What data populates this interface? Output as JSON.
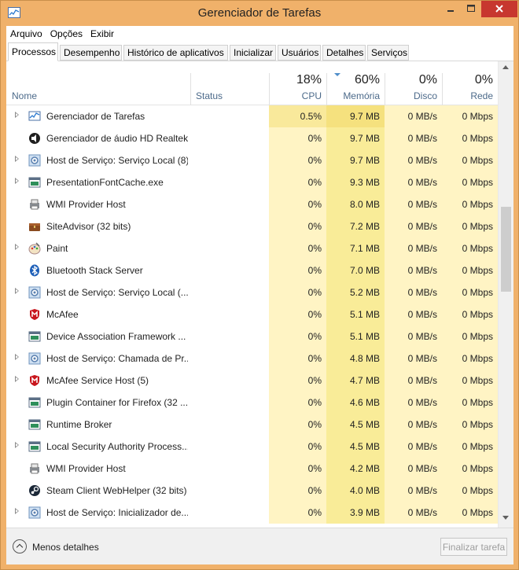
{
  "window": {
    "title": "Gerenciador de Tarefas",
    "controls": {
      "minimize": "–",
      "maximize": "□",
      "close": "✕"
    }
  },
  "menu": [
    "Arquivo",
    "Opções",
    "Exibir"
  ],
  "tabs": [
    "Processos",
    "Desempenho",
    "Histórico de aplicativos",
    "Inicializar",
    "Usuários",
    "Detalhes",
    "Serviços"
  ],
  "active_tab": "Processos",
  "columns": {
    "name": "Nome",
    "status": "Status",
    "cpu": {
      "percent": "18%",
      "label": "CPU"
    },
    "memory": {
      "percent": "60%",
      "label": "Memória"
    },
    "disk": {
      "percent": "0%",
      "label": "Disco"
    },
    "network": {
      "percent": "0%",
      "label": "Rede"
    }
  },
  "processes": [
    {
      "name": "Gerenciador de Tarefas",
      "cpu": "0.5%",
      "memory": "9.7 MB",
      "disk": "0 MB/s",
      "network": "0 Mbps",
      "icon": "task-manager-icon",
      "expandable": true
    },
    {
      "name": "Gerenciador de áudio HD Realtek",
      "cpu": "0%",
      "memory": "9.7 MB",
      "disk": "0 MB/s",
      "network": "0 Mbps",
      "icon": "speaker-icon",
      "expandable": false
    },
    {
      "name": "Host de Serviço: Serviço Local (8)",
      "cpu": "0%",
      "memory": "9.7 MB",
      "disk": "0 MB/s",
      "network": "0 Mbps",
      "icon": "gear-icon",
      "expandable": true
    },
    {
      "name": "PresentationFontCache.exe",
      "cpu": "0%",
      "memory": "9.3 MB",
      "disk": "0 MB/s",
      "network": "0 Mbps",
      "icon": "window-icon",
      "expandable": true
    },
    {
      "name": "WMI Provider Host",
      "cpu": "0%",
      "memory": "8.0 MB",
      "disk": "0 MB/s",
      "network": "0 Mbps",
      "icon": "printer-icon",
      "expandable": false
    },
    {
      "name": "SiteAdvisor (32 bits)",
      "cpu": "0%",
      "memory": "7.2 MB",
      "disk": "0 MB/s",
      "network": "0 Mbps",
      "icon": "chest-icon",
      "expandable": false
    },
    {
      "name": "Paint",
      "cpu": "0%",
      "memory": "7.1 MB",
      "disk": "0 MB/s",
      "network": "0 Mbps",
      "icon": "palette-icon",
      "expandable": true
    },
    {
      "name": "Bluetooth Stack Server",
      "cpu": "0%",
      "memory": "7.0 MB",
      "disk": "0 MB/s",
      "network": "0 Mbps",
      "icon": "bluetooth-icon",
      "expandable": false
    },
    {
      "name": "Host de Serviço: Serviço Local (...",
      "cpu": "0%",
      "memory": "5.2 MB",
      "disk": "0 MB/s",
      "network": "0 Mbps",
      "icon": "gear-icon",
      "expandable": true
    },
    {
      "name": "McAfee",
      "cpu": "0%",
      "memory": "5.1 MB",
      "disk": "0 MB/s",
      "network": "0 Mbps",
      "icon": "mcafee-shield-icon",
      "expandable": false
    },
    {
      "name": "Device Association Framework ...",
      "cpu": "0%",
      "memory": "5.1 MB",
      "disk": "0 MB/s",
      "network": "0 Mbps",
      "icon": "window-icon",
      "expandable": false
    },
    {
      "name": "Host de Serviço: Chamada de Pr...",
      "cpu": "0%",
      "memory": "4.8 MB",
      "disk": "0 MB/s",
      "network": "0 Mbps",
      "icon": "gear-icon",
      "expandable": true
    },
    {
      "name": "McAfee Service Host (5)",
      "cpu": "0%",
      "memory": "4.7 MB",
      "disk": "0 MB/s",
      "network": "0 Mbps",
      "icon": "mcafee-shield-icon",
      "expandable": true
    },
    {
      "name": "Plugin Container for Firefox (32 ...",
      "cpu": "0%",
      "memory": "4.6 MB",
      "disk": "0 MB/s",
      "network": "0 Mbps",
      "icon": "window-icon",
      "expandable": false
    },
    {
      "name": "Runtime Broker",
      "cpu": "0%",
      "memory": "4.5 MB",
      "disk": "0 MB/s",
      "network": "0 Mbps",
      "icon": "window-icon",
      "expandable": false
    },
    {
      "name": "Local Security Authority Process...",
      "cpu": "0%",
      "memory": "4.5 MB",
      "disk": "0 MB/s",
      "network": "0 Mbps",
      "icon": "window-icon",
      "expandable": true
    },
    {
      "name": "WMI Provider Host",
      "cpu": "0%",
      "memory": "4.2 MB",
      "disk": "0 MB/s",
      "network": "0 Mbps",
      "icon": "printer-icon",
      "expandable": false
    },
    {
      "name": "Steam Client WebHelper (32 bits)",
      "cpu": "0%",
      "memory": "4.0 MB",
      "disk": "0 MB/s",
      "network": "0 Mbps",
      "icon": "steam-icon",
      "expandable": false
    },
    {
      "name": "Host de Serviço: Inicializador de...",
      "cpu": "0%",
      "memory": "3.9 MB",
      "disk": "0 MB/s",
      "network": "0 Mbps",
      "icon": "gear-icon",
      "expandable": true
    }
  ],
  "footer": {
    "less_details": "Menos detalhes",
    "end_task": "Finalizar tarefa"
  }
}
